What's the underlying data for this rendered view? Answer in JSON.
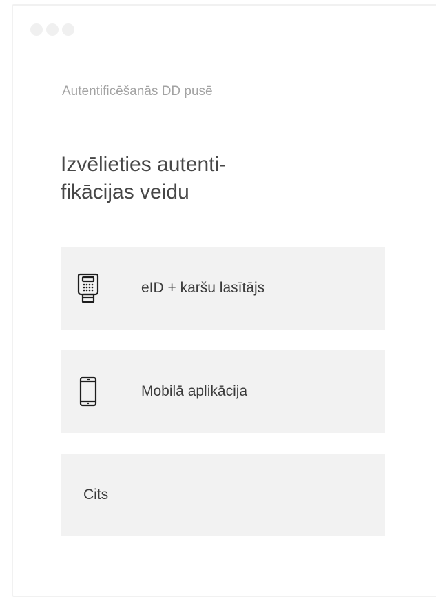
{
  "window": {
    "controls": [
      "dot-1",
      "dot-2",
      "dot-3"
    ]
  },
  "subtitle": "Autentificēšanās DD pusē",
  "heading": {
    "line1": "Izvēlieties autenti-",
    "line2": "fikācijas veidu"
  },
  "options": [
    {
      "label": "eID + karšu lasītājs",
      "icon": "card-reader-icon"
    },
    {
      "label": "Mobilā aplikācija",
      "icon": "mobile-phone-icon"
    },
    {
      "label": "Cits",
      "icon": null
    }
  ],
  "colors": {
    "option_bg": "#f2f2f2",
    "heading": "#474747",
    "subtitle": "#a3a3a3",
    "window_border": "#f1f1f1"
  }
}
